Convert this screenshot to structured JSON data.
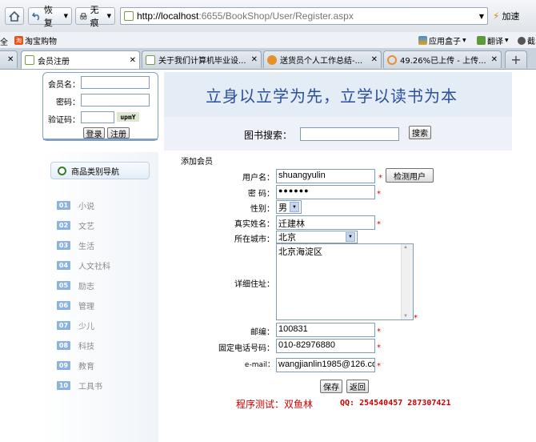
{
  "browser": {
    "back_label": "恢复",
    "traceless_label": "无痕",
    "url_host": "http://localhost",
    "url_rest": ":6655/BookShop/User/Register.aspx",
    "accel_label": "加速",
    "bookmarks": {
      "left_fragment": "全",
      "taobao": "淘宝购物",
      "apps": "应用盒子",
      "translate": "翻译",
      "right_fragment": "截"
    },
    "tabs": [
      {
        "title": "会员注册"
      },
      {
        "title": "关于我们计算机毕业设..."
      },
      {
        "title": "送货员个人工作总结-..."
      },
      {
        "title": "49.26%已上传 - 上传..."
      }
    ],
    "new_tab": "+"
  },
  "login": {
    "member_label": "会员名：",
    "password_label": "密码：",
    "captcha_label": "验证码：",
    "captcha_image_text": "upmY",
    "login_button": "登录",
    "register_button": "注册"
  },
  "banner": {
    "slogan": "立身以立学为先，立学以读书为本"
  },
  "search": {
    "label": "图书搜索：",
    "button": "搜索"
  },
  "sidebar": {
    "nav_title": "商品类别导航",
    "categories": [
      {
        "num": "01",
        "label": "小说"
      },
      {
        "num": "02",
        "label": "文艺"
      },
      {
        "num": "03",
        "label": "生活"
      },
      {
        "num": "04",
        "label": "人文社科"
      },
      {
        "num": "05",
        "label": "励志"
      },
      {
        "num": "06",
        "label": "管理"
      },
      {
        "num": "07",
        "label": "少儿"
      },
      {
        "num": "08",
        "label": "科技"
      },
      {
        "num": "09",
        "label": "教育"
      },
      {
        "num": "10",
        "label": "工具书"
      }
    ]
  },
  "form": {
    "section_title": "添加会员",
    "username_label": "用户名：",
    "username_value": "shuangyulin",
    "check_button": "检测用户",
    "password_label": "密  码：",
    "password_value": "●●●●●●",
    "gender_label": "性别：",
    "gender_value": "男",
    "realname_label": "真实姓名：",
    "realname_value": "迁建林",
    "city_label": "所在城市：",
    "city_value": "北京",
    "address_label": "详细住址：",
    "address_value": "北京海淀区",
    "postcode_label": "邮编：",
    "postcode_value": "100831",
    "phone_label": "固定电话号码：",
    "phone_value": "010-82976880",
    "email_label": "e-mail：",
    "email_value": "wangjianlin1985@126.com",
    "required_mark": "*",
    "save_button": "保存",
    "back_button": "返回"
  },
  "footer": {
    "tester": "程序测试：双鱼林",
    "qq": "QQ: 254540457 287307421"
  },
  "colors": {
    "accent": "#7fa0c8",
    "required": "#dd0000",
    "footer_text": "#cc0000",
    "slogan": "#2a4f9e"
  }
}
